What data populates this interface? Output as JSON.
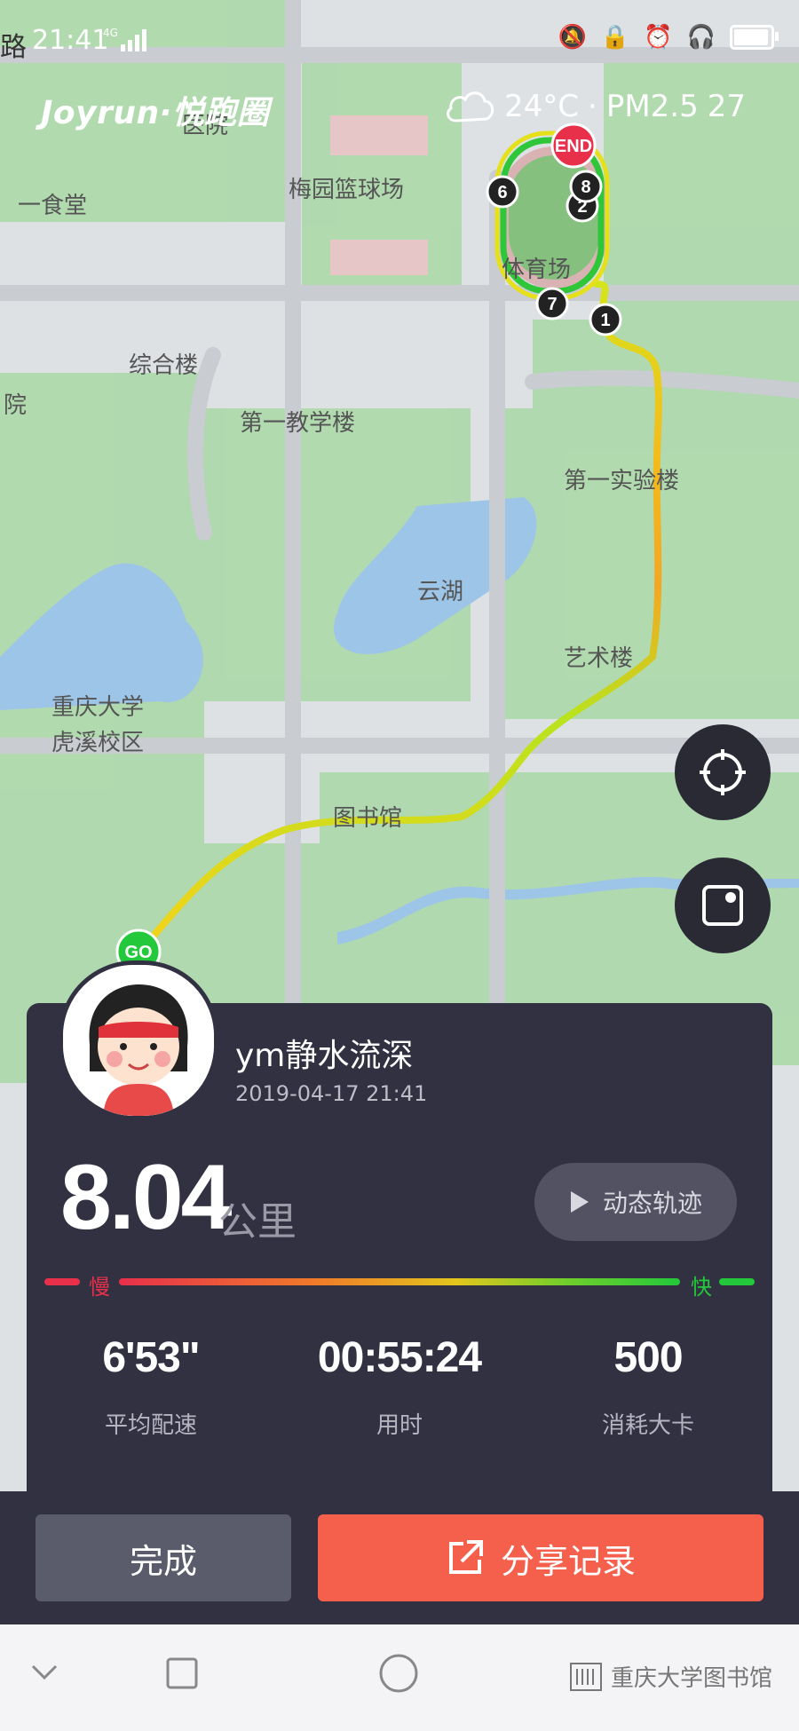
{
  "status_bar": {
    "left_text": "路",
    "time": "21:41",
    "network": "4G",
    "battery_level": 0.95
  },
  "brand": "Joyrun·悦跑圈",
  "weather": {
    "icon": "cloud-icon",
    "temperature": "24°C",
    "separator": "·",
    "pm_label": "PM2.5",
    "pm_value": "27"
  },
  "map": {
    "labels": [
      "医院",
      "梅园篮球场",
      "一食堂",
      "体育场",
      "综合楼",
      "第一教学楼",
      "第一实验楼",
      "云湖",
      "艺术楼",
      "重庆大学",
      "虎溪校区",
      "图书馆",
      "院"
    ],
    "start_label": "GO",
    "end_label": "END",
    "km_markers": [
      "1",
      "2",
      "6",
      "7",
      "8"
    ],
    "colors": {
      "slow": "#e8304b",
      "mid": "#f5a623",
      "fast": "#23c93b",
      "route_glow": "#d4e51a"
    }
  },
  "user": {
    "name": "ym静水流深",
    "datetime": "2019-04-17 21:41"
  },
  "run": {
    "distance": "8.04",
    "distance_unit": "公里",
    "track_button": "动态轨迹",
    "speed_slow": "慢",
    "speed_fast": "快",
    "stats": [
      {
        "value": "6'53\"",
        "label": "平均配速"
      },
      {
        "value": "00:55:24",
        "label": "用时"
      },
      {
        "value": "500",
        "label": "消耗大卡"
      }
    ]
  },
  "actions": {
    "done": "完成",
    "share": "分享记录"
  },
  "watermark": "重庆大学图书馆"
}
